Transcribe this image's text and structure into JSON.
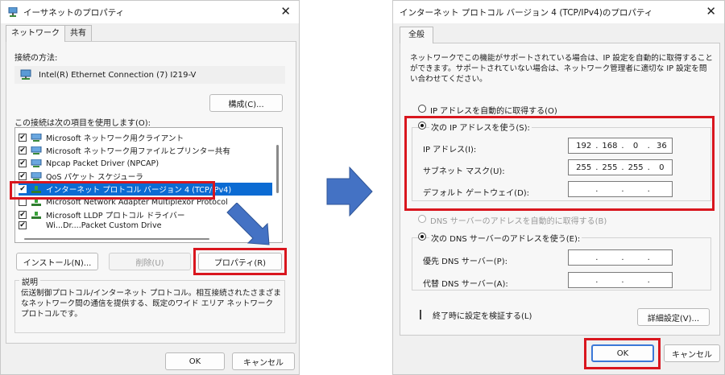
{
  "left": {
    "title": "イーサネットのプロパティ",
    "tabs": [
      "ネットワーク",
      "共有"
    ],
    "connect_using_label": "接続の方法:",
    "adapter_name": "Intel(R) Ethernet Connection (7) I219-V",
    "configure_button": "構成(C)...",
    "items_label": "この接続は次の項目を使用します(O):",
    "items": [
      {
        "label": "Microsoft ネットワーク用クライアント",
        "checked": true,
        "icon": "network-client-icon"
      },
      {
        "label": "Microsoft ネットワーク用ファイルとプリンター共有",
        "checked": true,
        "icon": "file-share-icon"
      },
      {
        "label": "Npcap Packet Driver (NPCAP)",
        "checked": true,
        "icon": "driver-icon"
      },
      {
        "label": "QoS パケット スケジューラ",
        "checked": true,
        "icon": "qos-icon"
      },
      {
        "label": "インターネット プロトコル バージョン 4 (TCP/IPv4)",
        "checked": true,
        "icon": "protocol-icon"
      },
      {
        "label": "Microsoft Network Adapter Multiplexor Protocol",
        "checked": false,
        "icon": "protocol-icon"
      },
      {
        "label": "Microsoft LLDP プロトコル ドライバー",
        "checked": true,
        "icon": "protocol-icon"
      },
      {
        "label": "Wi...Dr....Packet Custom Drive",
        "checked": true,
        "icon": "protocol-icon"
      }
    ],
    "install_button": "インストール(N)...",
    "uninstall_button": "削除(U)",
    "properties_button": "プロパティ(R)",
    "description_group": "説明",
    "description_text": "伝送制御プロトコル/インターネット プロトコル。相互接続されたさまざまなネットワーク間の通信を提供する、既定のワイド エリア ネットワーク プロトコルです。",
    "ok_button": "OK",
    "cancel_button": "キャンセル"
  },
  "right": {
    "title": "インターネット プロトコル バージョン 4 (TCP/IPv4)のプロパティ",
    "tab": "全般",
    "intro": "ネットワークでこの機能がサポートされている場合は、IP 設定を自動的に取得することができます。サポートされていない場合は、ネットワーク管理者に適切な IP 設定を問い合わせてください。",
    "auto_ip_label": "IP アドレスを自動的に取得する(O)",
    "manual_ip_label": "次の IP アドレスを使う(S):",
    "ip_label": "IP アドレス(I):",
    "ip_value": [
      "192",
      "168",
      "0",
      "36"
    ],
    "mask_label": "サブネット マスク(U):",
    "mask_value": [
      "255",
      "255",
      "255",
      "0"
    ],
    "gateway_label": "デフォルト ゲートウェイ(D):",
    "auto_dns_label": "DNS サーバーのアドレスを自動的に取得する(B)",
    "manual_dns_label": "次の DNS サーバーのアドレスを使う(E):",
    "preferred_dns_label": "優先 DNS サーバー(P):",
    "alternate_dns_label": "代替 DNS サーバー(A):",
    "validate_label": "終了時に設定を検証する(L)",
    "advanced_button": "詳細設定(V)...",
    "ok_button": "OK",
    "cancel_button": "キャンセル"
  },
  "colors": {
    "highlight_red": "#d9161e",
    "arrow_blue": "#4472c4",
    "selection_blue": "#0b6bd3"
  }
}
